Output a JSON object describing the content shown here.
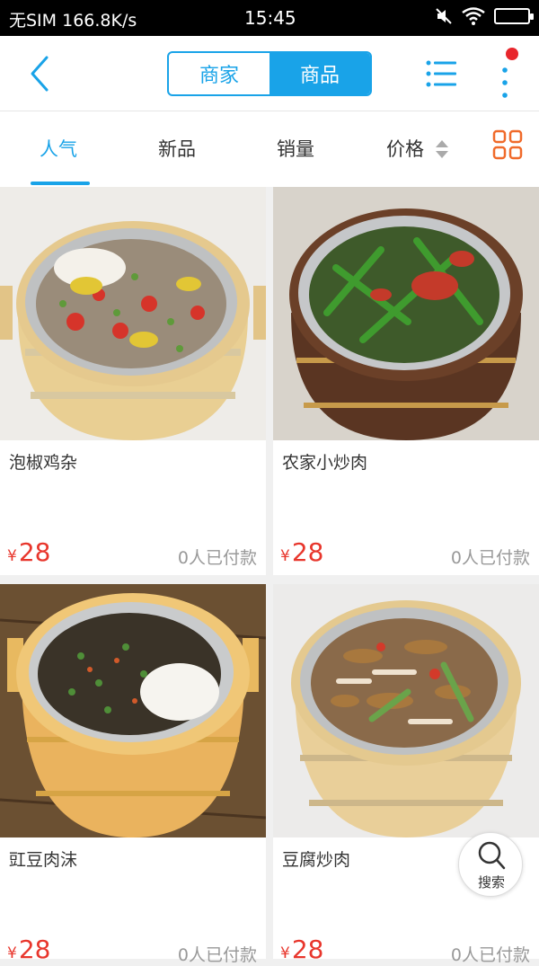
{
  "status_bar": {
    "carrier": "无SIM",
    "speed": "166.8K/s",
    "time": "15:45"
  },
  "header": {
    "segments": [
      "商家",
      "商品"
    ],
    "active_segment": "商品",
    "has_notification_dot": true
  },
  "sort_tabs": {
    "items": [
      "人气",
      "新品",
      "销量",
      "价格"
    ],
    "active": "人气"
  },
  "products": [
    {
      "name": "泡椒鸡杂",
      "currency": "¥",
      "price": "28",
      "sold": "0人已付款"
    },
    {
      "name": "农家小炒肉",
      "currency": "¥",
      "price": "28",
      "sold": "0人已付款"
    },
    {
      "name": "豇豆肉沫",
      "currency": "¥",
      "price": "28",
      "sold": "0人已付款"
    },
    {
      "name": "豆腐炒肉",
      "currency": "¥",
      "price": "28",
      "sold": "0人已付款"
    }
  ],
  "search_button": {
    "label": "搜索"
  },
  "colors": {
    "accent": "#19a3e8",
    "price": "#e8362c",
    "grid_icon": "#f06a2a",
    "notification": "#e8262c"
  },
  "icons": [
    "back-icon",
    "list-icon",
    "more-icon",
    "sort-arrows-icon",
    "grid-view-icon",
    "search-icon",
    "mute-icon",
    "wifi-icon",
    "battery-icon"
  ]
}
